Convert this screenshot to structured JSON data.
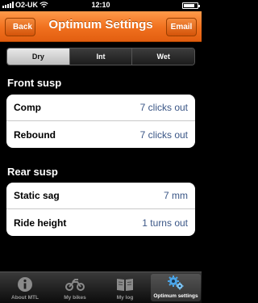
{
  "status_bar": {
    "carrier": "O2-UK",
    "time": "12:10",
    "battery_level": 0.85
  },
  "nav": {
    "back_label": "Back",
    "title": "Optimum Settings",
    "email_label": "Email"
  },
  "segments": {
    "items": [
      "Dry",
      "Int",
      "Wet"
    ],
    "selected": "Dry"
  },
  "front": {
    "title": "Front susp",
    "rows": [
      {
        "label": "Comp",
        "value": "7 clicks out"
      },
      {
        "label": "Rebound",
        "value": "7 clicks out"
      }
    ]
  },
  "rear": {
    "title": "Rear susp",
    "rows": [
      {
        "label": "Static sag",
        "value": "7 mm"
      },
      {
        "label": "Ride height",
        "value": "1 turns out"
      }
    ]
  },
  "tabs": [
    {
      "label": "About MTL",
      "icon": "info-icon"
    },
    {
      "label": "My bikes",
      "icon": "motorbike-icon"
    },
    {
      "label": "My log",
      "icon": "logbook-icon"
    },
    {
      "label": "Optimum settings",
      "icon": "gears-icon"
    }
  ],
  "colors": {
    "accent": "#f0701e",
    "value_text": "#3a5686"
  }
}
